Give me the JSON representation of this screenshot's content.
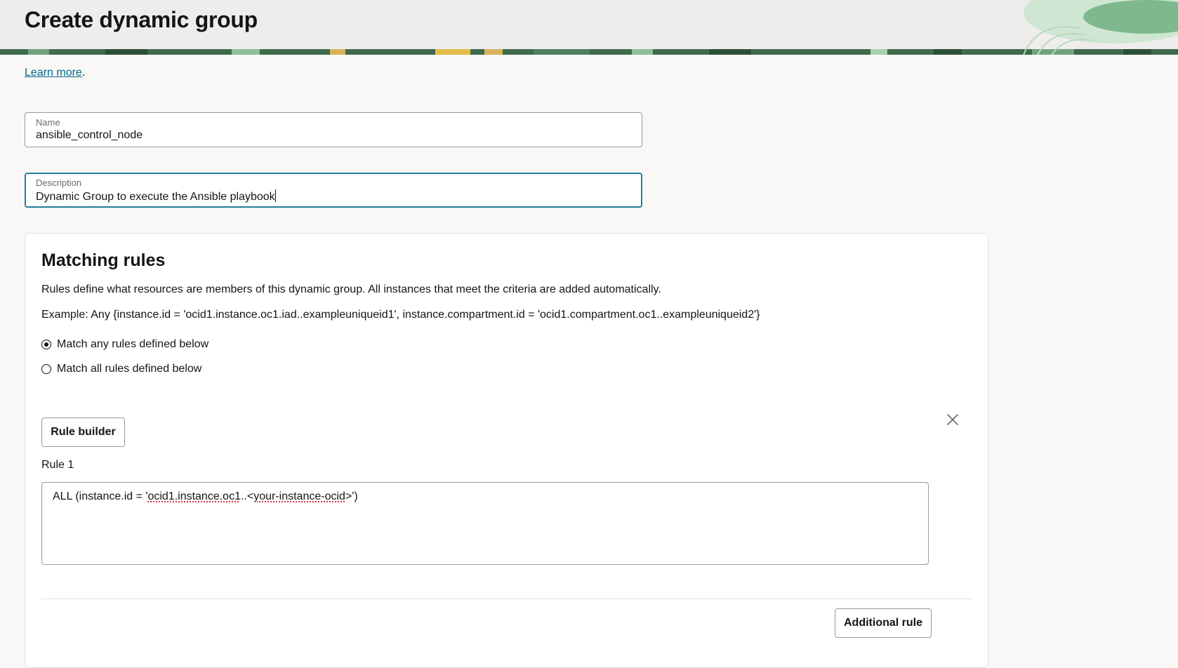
{
  "page": {
    "title": "Create dynamic group",
    "learn_more": "Learn more",
    "learn_more_suffix": "."
  },
  "name_field": {
    "label": "Name",
    "value": "ansible_control_node"
  },
  "description_field": {
    "label": "Description",
    "value": "Dynamic Group to execute the Ansible playbook"
  },
  "matching_rules": {
    "title": "Matching rules",
    "intro": "Rules define what resources are members of this dynamic group. All instances that meet the criteria are added automatically.",
    "example": "Example: Any {instance.id = 'ocid1.instance.oc1.iad..exampleuniqueid1', instance.compartment.id = 'ocid1.compartment.oc1..exampleuniqueid2'}",
    "options": [
      {
        "label": "Match any rules defined below",
        "checked": true
      },
      {
        "label": "Match all rules defined below",
        "checked": false
      }
    ],
    "rule_builder_label": "Rule builder",
    "rules": [
      {
        "label": "Rule 1",
        "text_prefix": "ALL (instance.id = '",
        "text_ocid": "ocid1.instance.oc1",
        "text_mid": "..<",
        "text_placeholder": "your-instance-ocid",
        "text_suffix": ">')"
      }
    ],
    "additional_rule_label": "Additional rule"
  },
  "colors": {
    "link": "#00688c",
    "focus_border": "#227e9e",
    "header_bg": "#efedeb",
    "page_bg": "#f9f8f6"
  }
}
